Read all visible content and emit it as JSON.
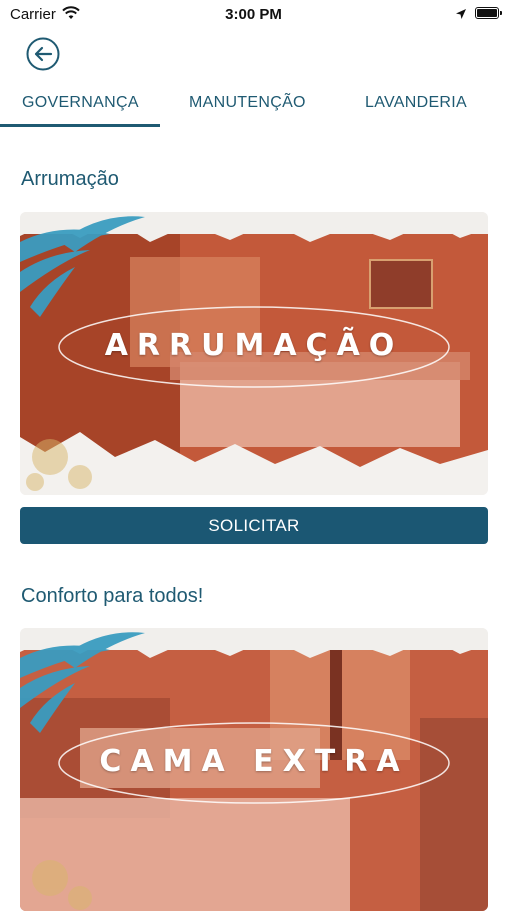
{
  "status_bar": {
    "carrier": "Carrier",
    "time": "3:00 PM"
  },
  "tabs": [
    {
      "label": "GOVERNANÇA",
      "active": true
    },
    {
      "label": "MANUTENÇÃO",
      "active": false
    },
    {
      "label": "LAVANDERIA",
      "active": false
    }
  ],
  "colors": {
    "primary": "#1b5773",
    "card_overlay": "#b4502f",
    "leaf": "#3a9cc0"
  },
  "sections": [
    {
      "title": "Arrumação",
      "card_label": "ARRUMAÇÃO",
      "button": "SOLICITAR"
    },
    {
      "title": "Conforto para todos!",
      "card_label": "CAMA EXTRA"
    }
  ]
}
